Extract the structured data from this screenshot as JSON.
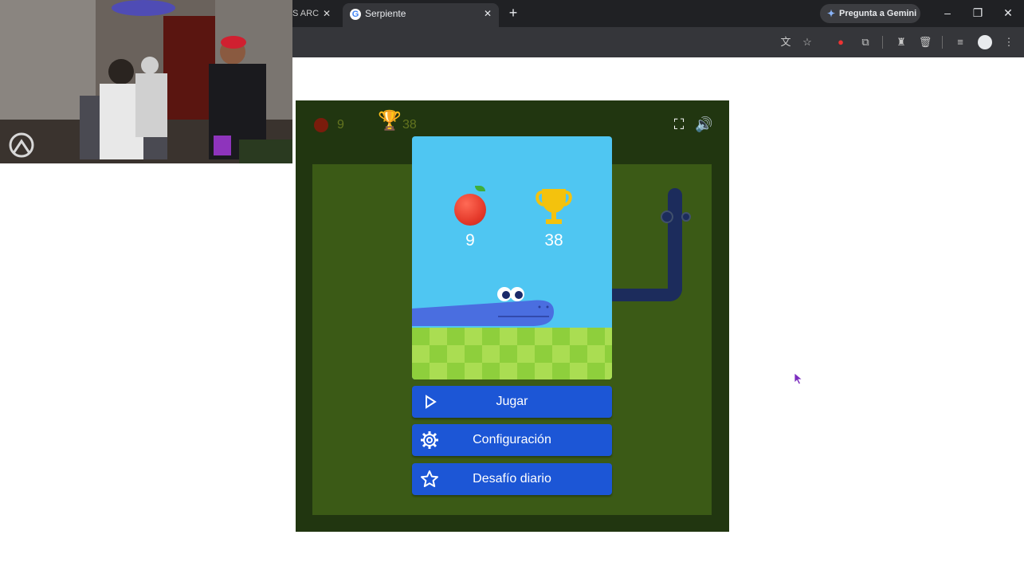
{
  "browser": {
    "tabs": [
      {
        "label": "S ARC",
        "active": false
      },
      {
        "label": "Serpiente",
        "active": true
      }
    ],
    "gemini_button": "Pregunta a Gemini"
  },
  "game": {
    "top_score": "9",
    "top_best": "38",
    "panel_score": "9",
    "panel_best": "38",
    "buttons": {
      "play": "Jugar",
      "settings": "Configuración",
      "daily": "Desafío diario"
    }
  },
  "colors": {
    "game_bg": "#213610",
    "field": "#3b5a16",
    "panel_sky": "#4fc6f2",
    "button_blue": "#1c56d6",
    "snake": "#4a6ee0",
    "cursor": "#7b2cbf"
  }
}
